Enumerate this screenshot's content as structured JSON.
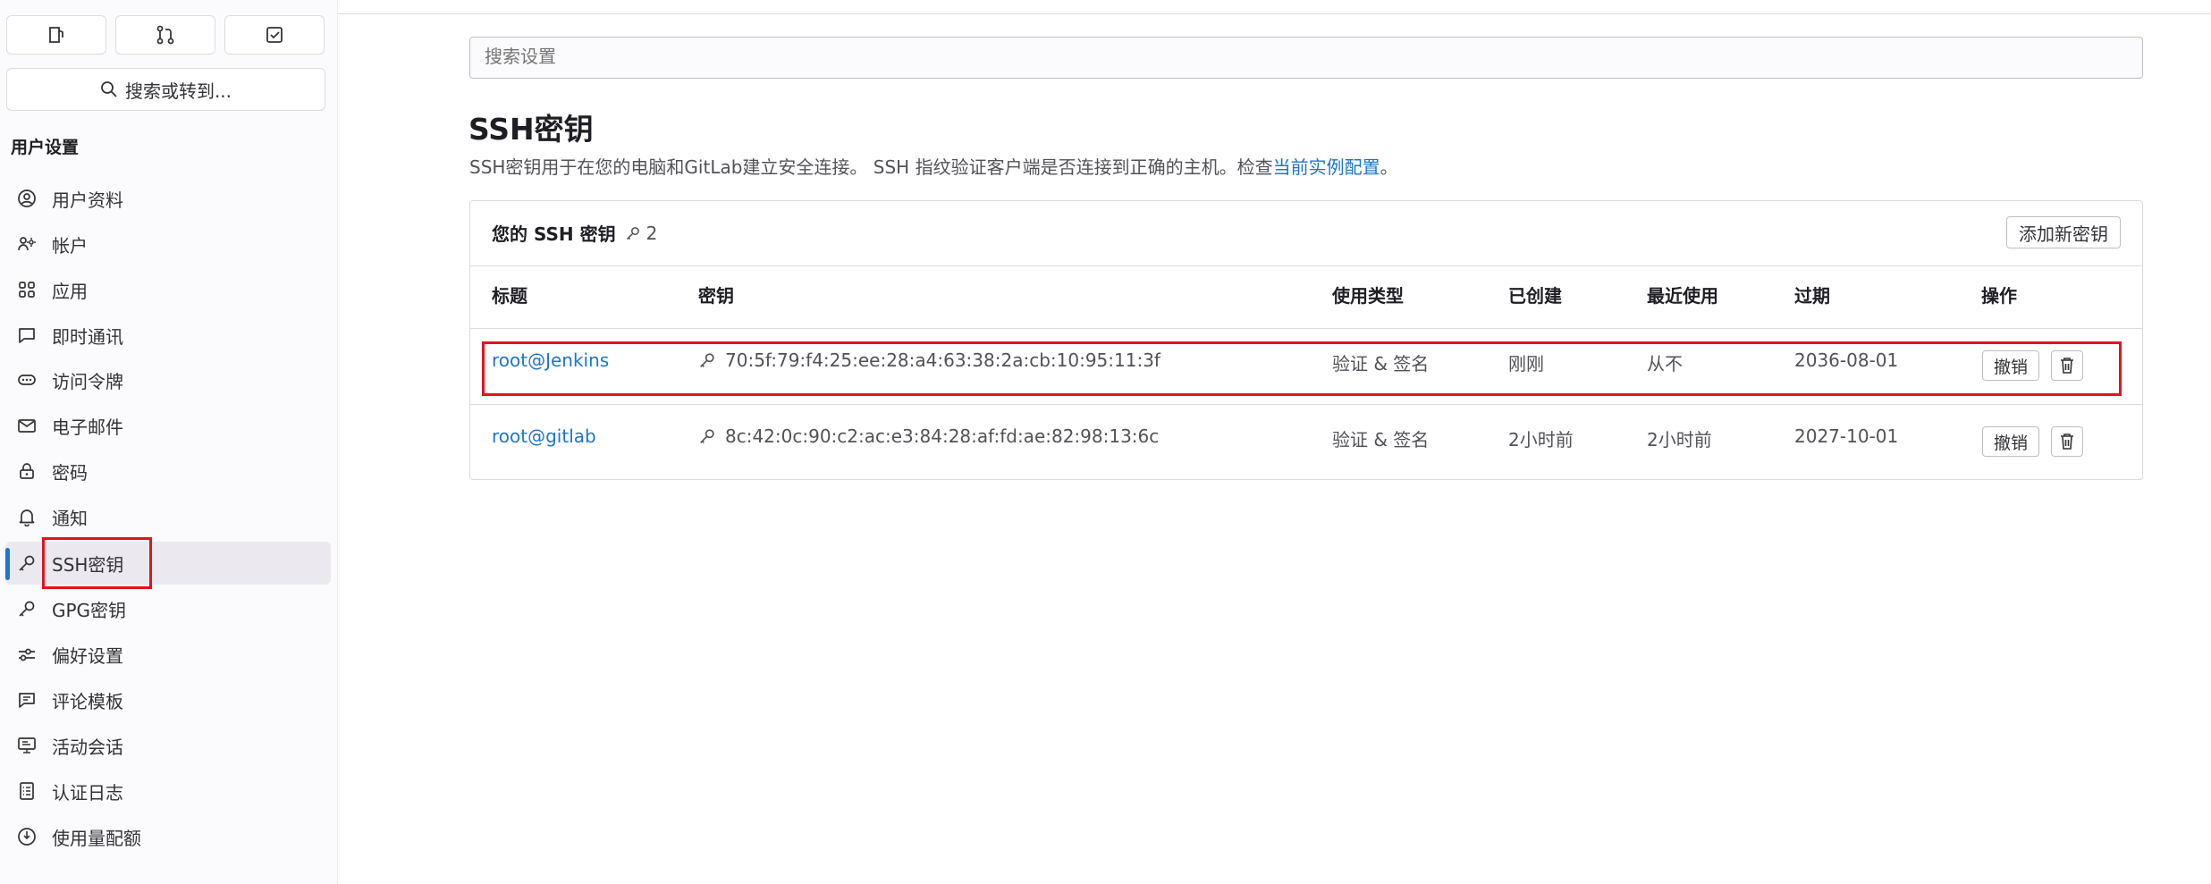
{
  "sidebar": {
    "search_label": "搜索或转到...",
    "section_title": "用户设置",
    "items": [
      {
        "label": "用户资料",
        "icon": "user-circle-icon"
      },
      {
        "label": "帐户",
        "icon": "user-settings-icon"
      },
      {
        "label": "应用",
        "icon": "applications-icon"
      },
      {
        "label": "即时通讯",
        "icon": "comment-icon"
      },
      {
        "label": "访问令牌",
        "icon": "token-icon"
      },
      {
        "label": "电子邮件",
        "icon": "mail-icon"
      },
      {
        "label": "密码",
        "icon": "lock-icon"
      },
      {
        "label": "通知",
        "icon": "bell-icon"
      },
      {
        "label": "SSH密钥",
        "icon": "key-icon"
      },
      {
        "label": "GPG密钥",
        "icon": "key-icon"
      },
      {
        "label": "偏好设置",
        "icon": "preferences-icon"
      },
      {
        "label": "评论模板",
        "icon": "comment-lines-icon"
      },
      {
        "label": "活动会话",
        "icon": "monitor-icon"
      },
      {
        "label": "认证日志",
        "icon": "log-icon"
      },
      {
        "label": "使用量配额",
        "icon": "quota-icon"
      }
    ]
  },
  "main": {
    "search_placeholder": "搜索设置",
    "title": "SSH密钥",
    "description": "SSH密钥用于在您的电脑和GitLab建立安全连接。 SSH 指纹验证客户端是否连接到正确的主机。检查",
    "description_link": "当前实例配置",
    "description_end": "。",
    "card": {
      "heading": "您的 SSH 密钥",
      "count": "2",
      "add_button": "添加新密钥",
      "columns": [
        "标题",
        "密钥",
        "使用类型",
        "已创建",
        "最近使用",
        "过期",
        "操作"
      ],
      "rows": [
        {
          "title": "root@Jenkins",
          "fingerprint": "70:5f:79:f4:25:ee:28:a4:63:38:2a:cb:10:95:11:3f",
          "usage": "验证 & 签名",
          "created": "刚刚",
          "last_used": "从不",
          "expires": "2036-08-01",
          "revoke": "撤销"
        },
        {
          "title": "root@gitlab",
          "fingerprint": "8c:42:0c:90:c2:ac:e3:84:28:af:fd:ae:82:98:13:6c",
          "usage": "验证 & 签名",
          "created": "2小时前",
          "last_used": "2小时前",
          "expires": "2027-10-01",
          "revoke": "撤销"
        }
      ]
    }
  },
  "colors": {
    "link": "#1f75cb",
    "highlight": "#e0141e",
    "active_bar": "#1f75cb"
  }
}
